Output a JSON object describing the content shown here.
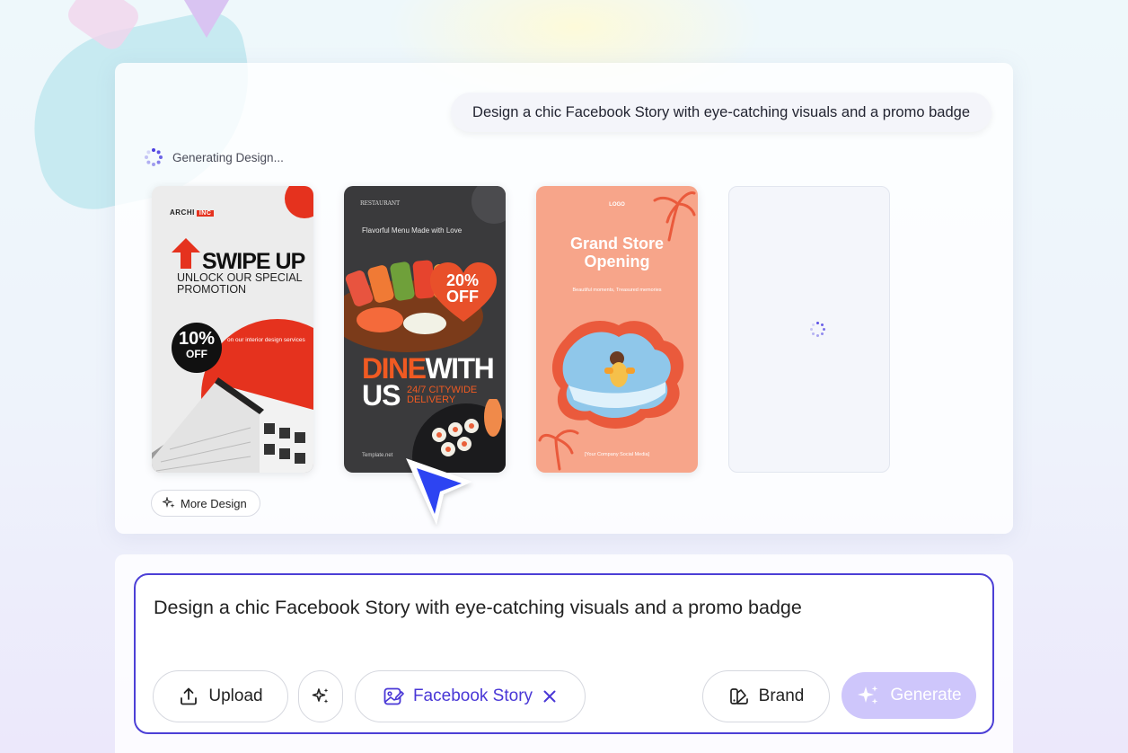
{
  "prompt_bubble": "Design a chic Facebook Story with eye-catching visuals and a promo badge",
  "status_text": "Generating Design...",
  "cards": {
    "c1": {
      "logo": "ARCHI",
      "logo_tag": "INC",
      "title": "SWIPE UP",
      "subtitle": "UNLOCK OUR SPECIAL PROMOTION",
      "badge_num": "10%",
      "badge_off": "OFF",
      "note": "on our interior design services"
    },
    "c2": {
      "logo": "RESTAURANT",
      "tagline": "Flavorful Menu Made with Love",
      "badge_num": "20%",
      "badge_off": "OFF",
      "dine": "DINE",
      "with": "WITH",
      "us": "US",
      "delivery": "24/7 CITYWIDE DELIVERY",
      "site": "Template.net"
    },
    "c3": {
      "logo": "LOGO",
      "title_line1": "Grand Store",
      "title_line2": "Opening",
      "subtitle": "Beautiful moments, Treasured memories",
      "footer": "[Your Company Social Media]"
    }
  },
  "more_design_label": "More Design",
  "input": {
    "value": "Design a chic Facebook Story with eye-catching visuals and a promo badge"
  },
  "buttons": {
    "upload": "Upload",
    "format": "Facebook Story",
    "brand": "Brand",
    "generate": "Generate"
  },
  "colors": {
    "accent": "#4c3fd6",
    "generate_disabled": "#cec6fb",
    "promo_red": "#e5321e",
    "promo_orange": "#f05a22",
    "card3_bg": "#f7a58a"
  },
  "icons": [
    "upload-icon",
    "sparkle-icon",
    "image-edit-icon",
    "close-icon",
    "brand-icon",
    "cursor-icon",
    "spinner-icon"
  ]
}
